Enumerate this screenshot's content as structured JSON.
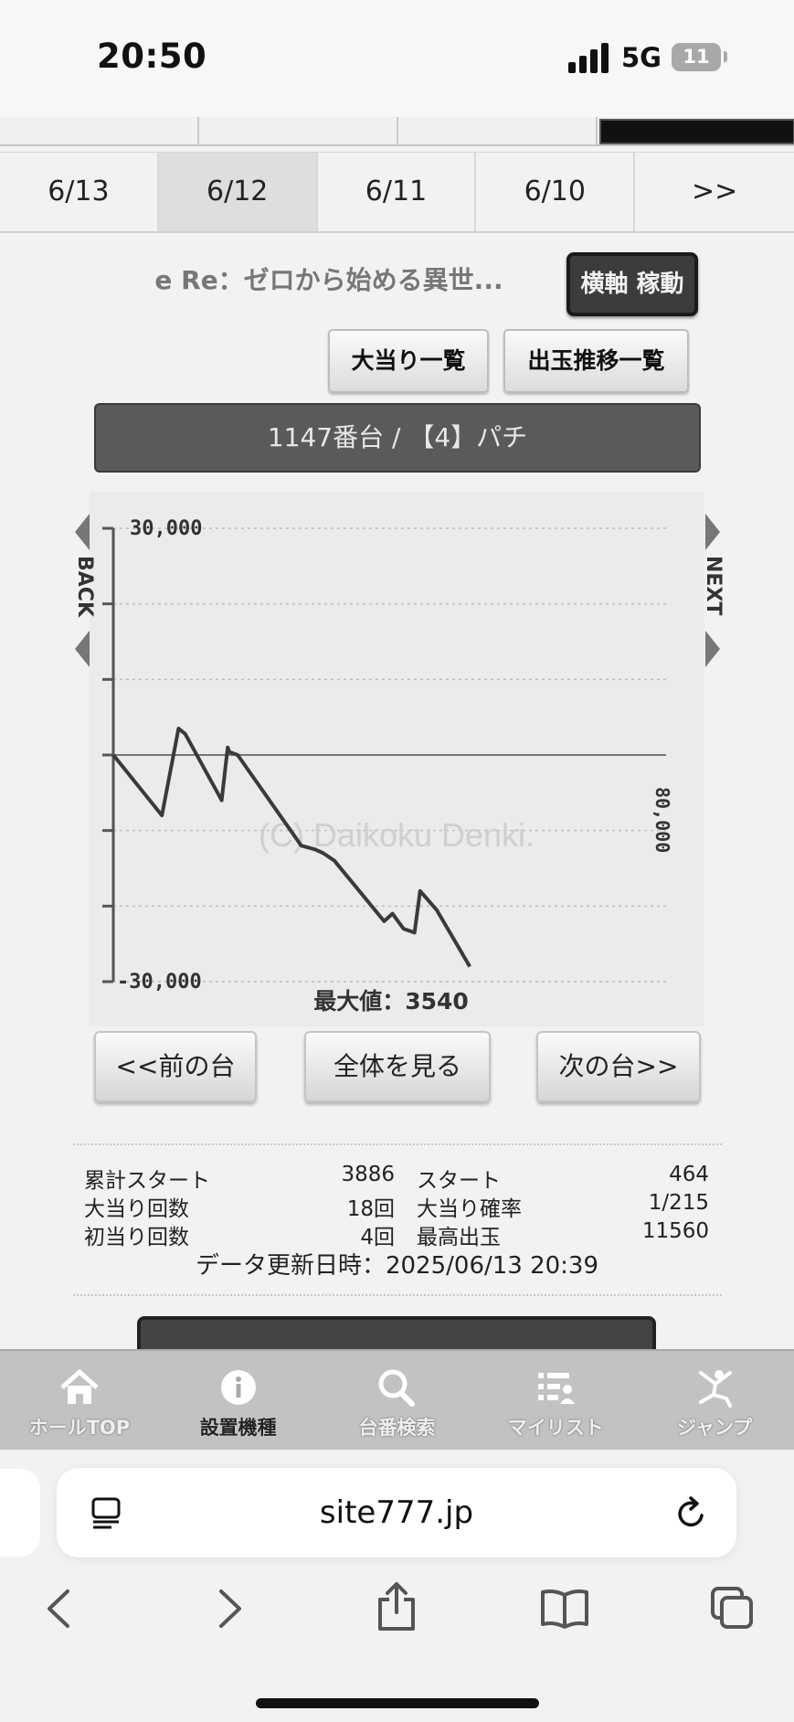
{
  "status_bar": {
    "time": "20:50",
    "network": "5G",
    "battery": "11"
  },
  "date_tabs": [
    "6/13",
    "6/12",
    "6/11",
    "6/10",
    ">>"
  ],
  "active_tab_index": 1,
  "header": {
    "machine_title": "e Re：ゼロから始める異世...",
    "yokojiku_button": "横軸 稼動",
    "jackpot_list_button": "大当り一覧",
    "payout_list_button": "出玉推移一覧",
    "machine_bar": "1147番台 / 【4】パチ"
  },
  "chart_data": {
    "type": "line",
    "y_top_label": "30,000",
    "y_bottom_label": "-30,000",
    "ylim": [
      -30000,
      30000
    ],
    "right_label": "80,000",
    "watermark": "(C) Daikoku Denki.",
    "max_label": "最大値：3540",
    "back_label": "BACK",
    "next_label": "NEXT",
    "x": [
      0,
      8.8,
      11.8,
      13,
      19.6,
      20.7,
      21,
      22.5,
      34,
      36.5,
      38,
      40,
      49,
      50.5,
      52.5,
      54.5,
      55.5,
      58.5,
      64.5
    ],
    "y": [
      0,
      -8000,
      3500,
      2800,
      -6000,
      1000,
      400,
      0,
      -12000,
      -12500,
      -13000,
      -14000,
      -22000,
      -21000,
      -23000,
      -23500,
      -18000,
      -20500,
      -28000
    ]
  },
  "nav_buttons": {
    "prev": "<<前の台",
    "all": "全体を見る",
    "next": "次の台>>"
  },
  "stats": {
    "left": [
      {
        "label": "累計スタート",
        "value": "3886"
      },
      {
        "label": "大当り回数",
        "value": "18回"
      },
      {
        "label": "初当り回数",
        "value": "4回"
      }
    ],
    "right": [
      {
        "label": "スタート",
        "value": "464"
      },
      {
        "label": "大当り確率",
        "value": "1/215"
      },
      {
        "label": "最高出玉",
        "value": "11560"
      }
    ],
    "updated": "データ更新日時：2025/06/13 20:39"
  },
  "bottom_nav": [
    {
      "label": "ホールTOP",
      "icon": "home-icon"
    },
    {
      "label": "設置機種",
      "icon": "info-icon"
    },
    {
      "label": "台番検索",
      "icon": "search-icon"
    },
    {
      "label": "マイリスト",
      "icon": "mylist-icon"
    },
    {
      "label": "ジャンプ",
      "icon": "jump-icon"
    }
  ],
  "browser": {
    "url": "site777.jp"
  }
}
